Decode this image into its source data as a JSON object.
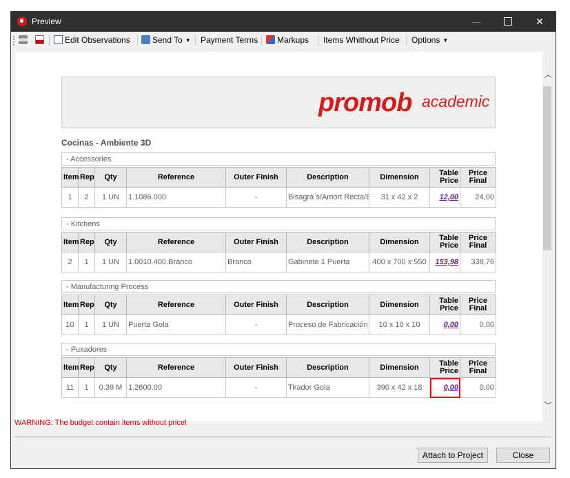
{
  "window": {
    "title": "Preview"
  },
  "toolbar": {
    "edit_observations": "Edit Observations",
    "send_to": "Send To",
    "payment_terms": "Payment Terms",
    "markups": "Markups",
    "items_without_price": "Items Whithout Price",
    "options": "Options"
  },
  "logo": {
    "main": "promob",
    "sub": "academic"
  },
  "section": {
    "title": "Cocinas - Ambiente 3D"
  },
  "columns": {
    "item": "Item",
    "rep": "Rep",
    "qty": "Qty",
    "reference": "Reference",
    "outer_finish": "Outer Finish",
    "description": "Description",
    "dimension": "Dimension",
    "table_price_1": "Table",
    "table_price_2": "Price",
    "price_final_1": "Price",
    "price_final_2": "Final"
  },
  "groups": [
    {
      "name": "- Accessories",
      "row": {
        "item": "1",
        "rep": "2",
        "qty": "1 UN",
        "reference": "1.1086.000",
        "outer_finish": "-",
        "description": "Bisagra s/Amort Recta/Baja",
        "dimension": "31 x 42 x 2",
        "table_price": "12,00",
        "price_final": "24,00"
      }
    },
    {
      "name": "- Kitchens",
      "row": {
        "item": "2",
        "rep": "1",
        "qty": "1 UN",
        "reference": "1.0010.400.Branco",
        "outer_finish": "Branco",
        "description": "Gabinete 1 Puerta",
        "dimension": "400 x 700 x 550",
        "table_price": "153,98",
        "price_final": "338,76"
      }
    },
    {
      "name": "- Manufacturing Process",
      "row": {
        "item": "10",
        "rep": "1",
        "qty": "1 UN",
        "reference": "Puerta Gola",
        "outer_finish": "-",
        "description": "Proceso de Fabricación",
        "dimension": "10 x 10 x 10",
        "table_price": "0,00",
        "price_final": "0,00"
      }
    },
    {
      "name": "- Puxadores",
      "row": {
        "item": "11",
        "rep": "1",
        "qty": "0.39 M",
        "reference": "1.2600.00",
        "outer_finish": "-",
        "description": "Tirador Gola",
        "dimension": "390 x 42 x 18",
        "table_price": "0,00",
        "price_final": "0,00"
      }
    }
  ],
  "footer": {
    "warning": "WARNING: The budget contain items without price!",
    "attach_button": "Attach to Project",
    "close_button": "Close"
  },
  "colors": {
    "titlebar": "#303030",
    "brand": "#d31d1d",
    "warning": "#d00000",
    "link": "#6a1a8a",
    "highlight": "#e01010"
  }
}
